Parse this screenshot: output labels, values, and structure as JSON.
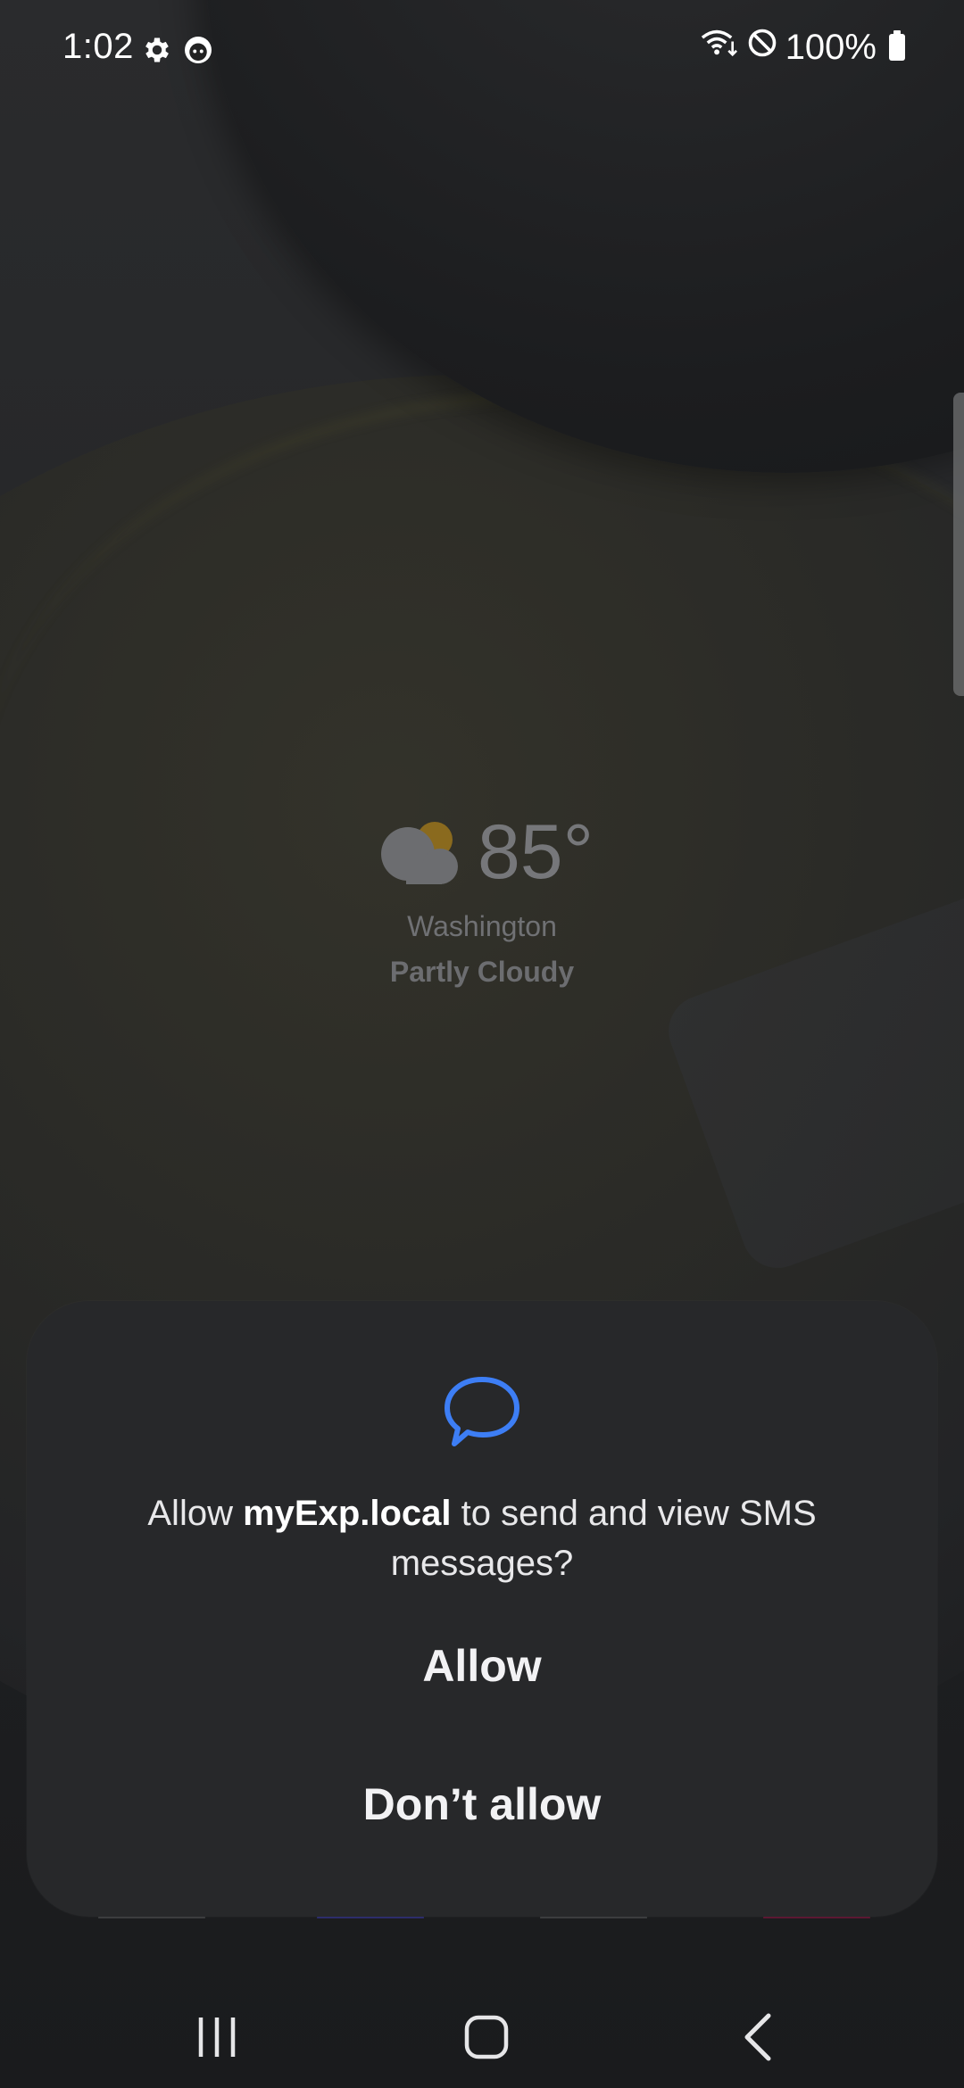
{
  "status_bar": {
    "time": "1:02",
    "left_icons": [
      "gear-icon",
      "assistant-face-icon"
    ],
    "battery_text": "100%",
    "right_icons": [
      "wifi-icon",
      "do-not-disturb-icon",
      "battery-icon"
    ]
  },
  "weather": {
    "temperature": "85°",
    "city": "Washington",
    "condition": "Partly Cloudy",
    "icon": "partly-cloudy-icon"
  },
  "dialog": {
    "icon": "chat-bubble-icon",
    "message_prefix": "Allow ",
    "app_name": "myExp.local",
    "message_suffix": " to send and view SMS messages?",
    "allow_label": "Allow",
    "deny_label": "Don’t allow",
    "accent_color": "#3d7ef5"
  },
  "navigation": {
    "recents": "recents-icon",
    "home": "home-icon",
    "back": "back-icon"
  }
}
